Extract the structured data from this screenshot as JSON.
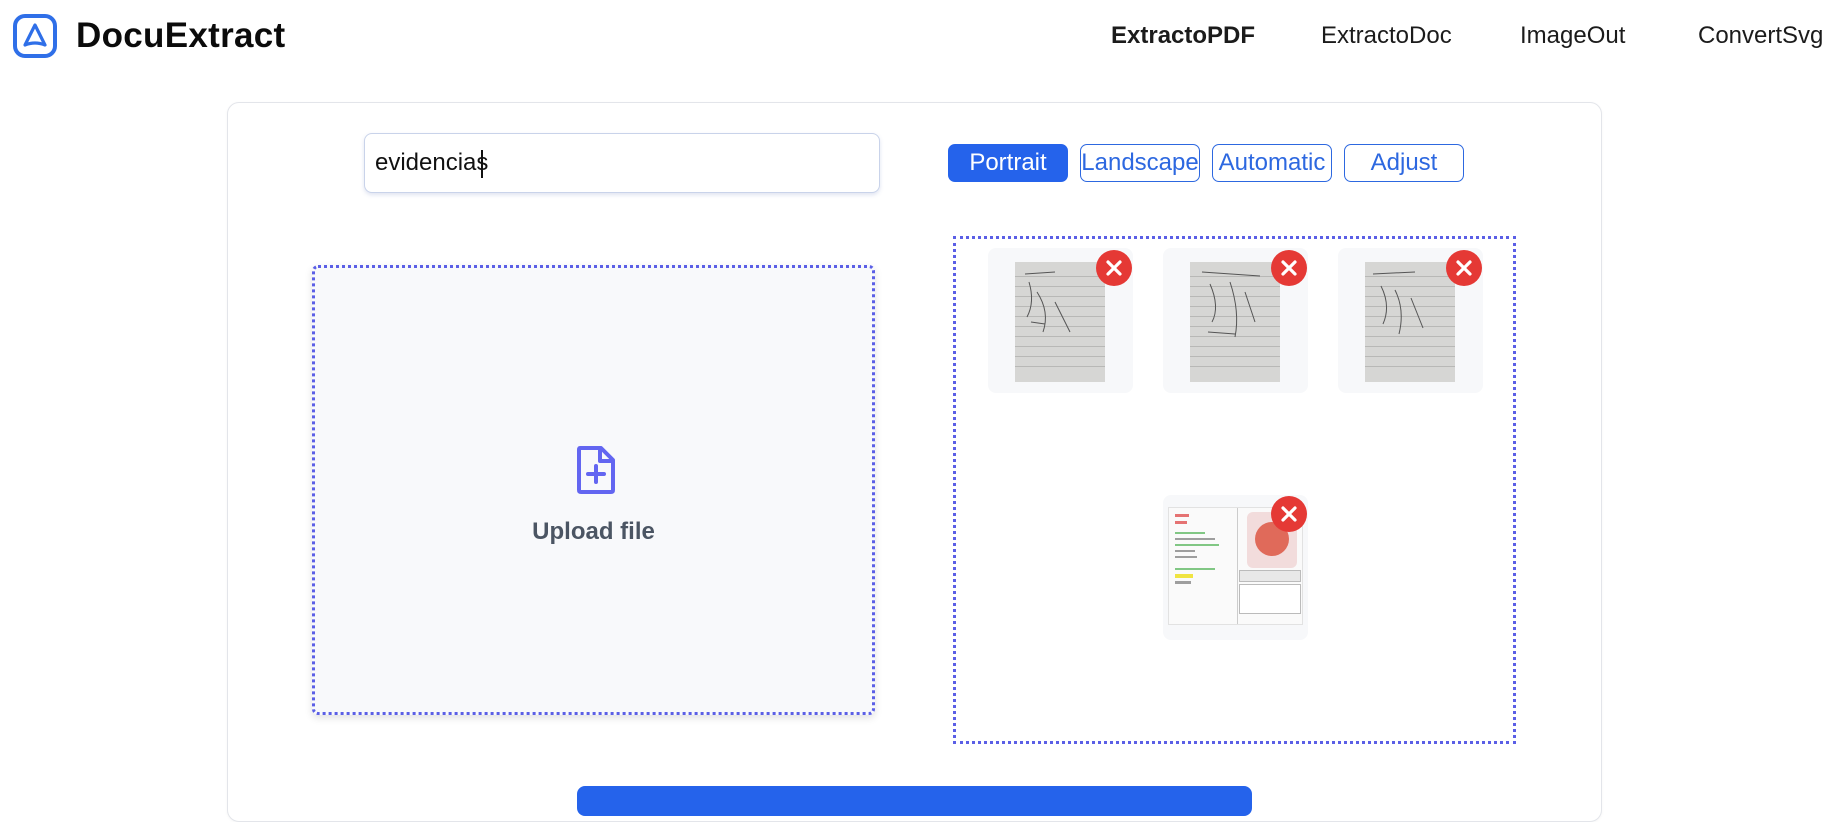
{
  "app": {
    "brand": "DocuExtract",
    "logo_icon": "a-letter-logo-icon",
    "accent_color": "#2563eb"
  },
  "nav": [
    {
      "label": "ExtractoPDF",
      "active": true
    },
    {
      "label": "ExtractoDoc",
      "active": false
    },
    {
      "label": "ImageOut",
      "active": false
    },
    {
      "label": "ConvertSvg",
      "active": false
    }
  ],
  "filename_input": {
    "value": "evidencias",
    "placeholder": ""
  },
  "orientation": {
    "options": [
      "Portrait",
      "Landscape",
      "Automatic",
      "Adjust"
    ],
    "selected": "Portrait"
  },
  "upload": {
    "label": "Upload file",
    "icon": "file-plus-icon"
  },
  "previews": {
    "count": 4,
    "remove_icon": "close-circle-icon",
    "items": [
      {
        "kind": "notebook-page"
      },
      {
        "kind": "notebook-page"
      },
      {
        "kind": "notebook-page"
      },
      {
        "kind": "screenshot"
      }
    ]
  }
}
